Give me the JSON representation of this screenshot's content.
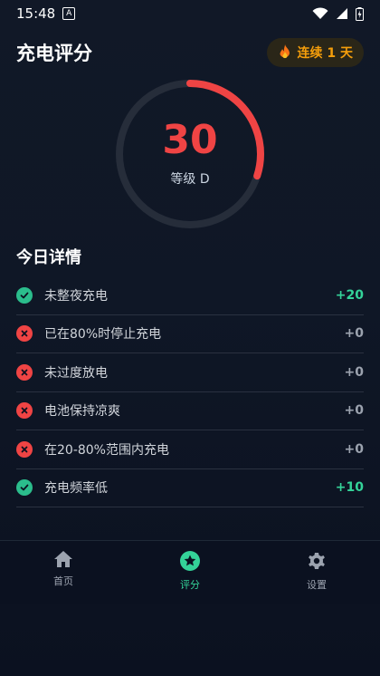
{
  "status_bar": {
    "time": "15:48",
    "app_icon": "A"
  },
  "header": {
    "title": "充电评分",
    "streak_label": "连续 1 天"
  },
  "gauge": {
    "score": "30",
    "grade": "等级 D",
    "progress": 0.3,
    "accent_color": "#ef4444"
  },
  "today": {
    "title": "今日详情",
    "items": [
      {
        "label": "未整夜充电",
        "value": "+20",
        "status": "ok"
      },
      {
        "label": "已在80%时停止充电",
        "value": "+0",
        "status": "bad"
      },
      {
        "label": "未过度放电",
        "value": "+0",
        "status": "bad"
      },
      {
        "label": "电池保持凉爽",
        "value": "+0",
        "status": "bad"
      },
      {
        "label": "在20-80%范围内充电",
        "value": "+0",
        "status": "bad"
      },
      {
        "label": "充电频率低",
        "value": "+10",
        "status": "ok"
      }
    ]
  },
  "nav": {
    "home": "首页",
    "score": "评分",
    "settings": "设置",
    "active": "score"
  },
  "colors": {
    "positive": "#34d399",
    "negative": "#ef4444",
    "streak": "#f59e0b"
  }
}
